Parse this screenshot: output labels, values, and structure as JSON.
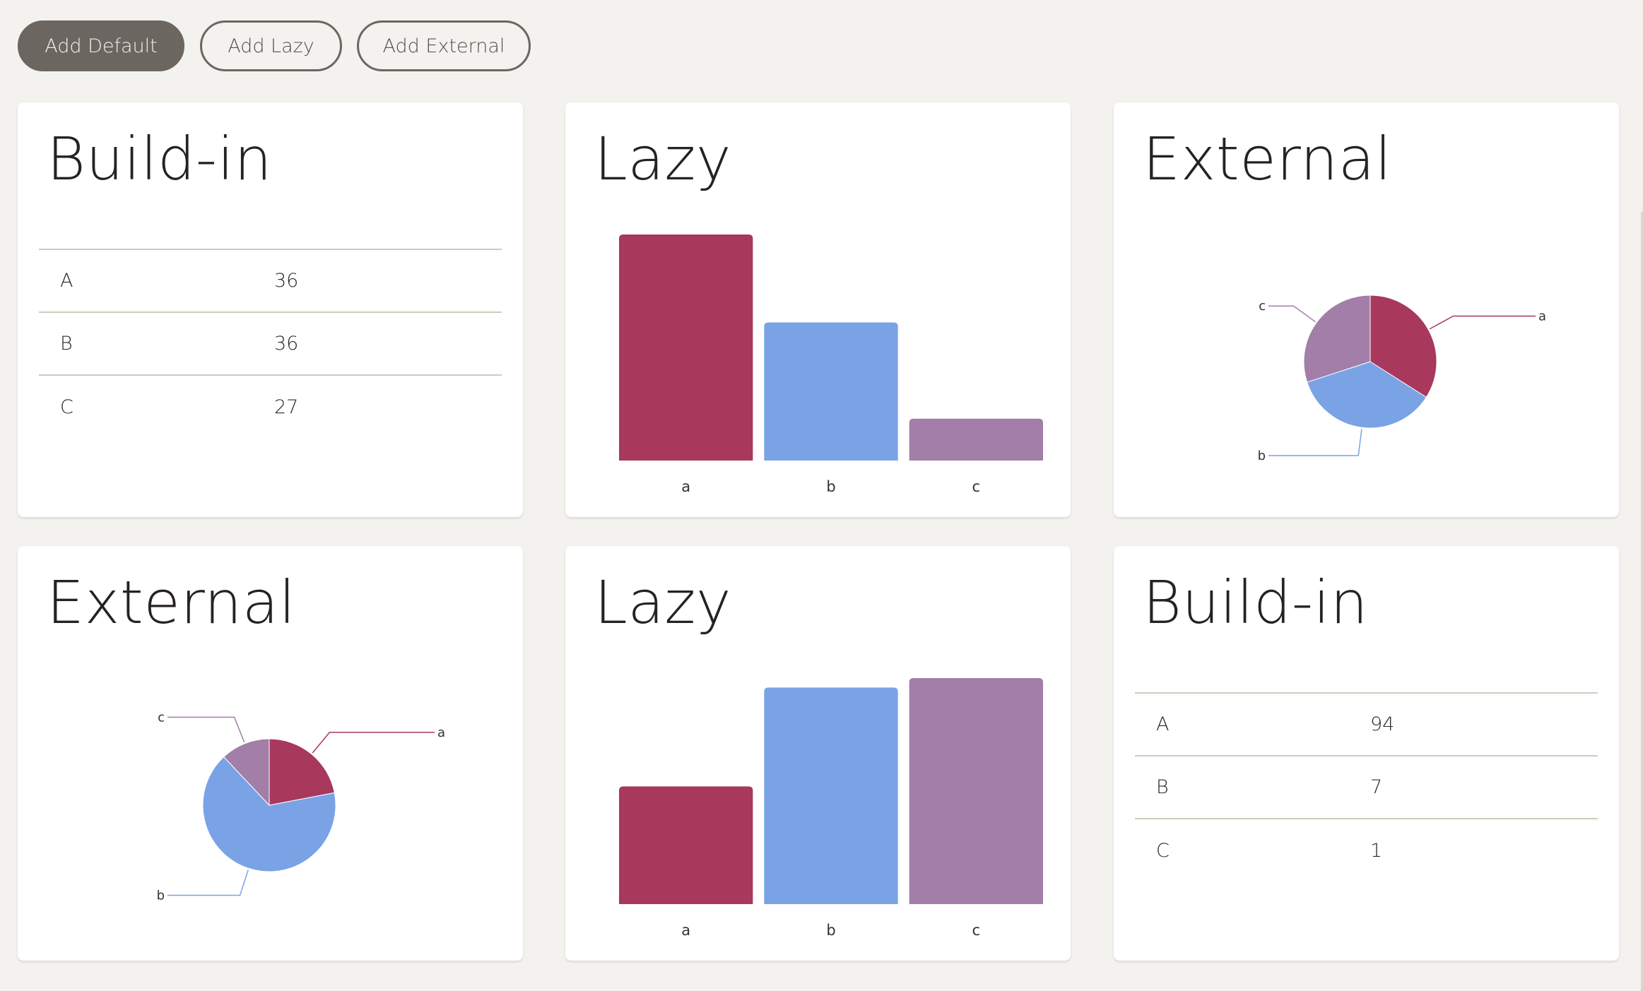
{
  "toolbar": {
    "add_default_label": "Add Default",
    "add_lazy_label": "Add Lazy",
    "add_external_label": "Add External"
  },
  "colors": {
    "a": "#a8385c",
    "b": "#7aa3e5",
    "c": "#a27ea8",
    "background": "#f3f2ef",
    "button_dark": "#6b6660"
  },
  "cards": [
    {
      "title": "Build-in",
      "kind": "table",
      "rows": [
        {
          "key": "A",
          "value": "36"
        },
        {
          "key": "B",
          "value": "36"
        },
        {
          "key": "C",
          "value": "27"
        }
      ]
    },
    {
      "title": "Lazy",
      "kind": "bar"
    },
    {
      "title": "External",
      "kind": "pie"
    },
    {
      "title": "External",
      "kind": "pie"
    },
    {
      "title": "Lazy",
      "kind": "bar"
    },
    {
      "title": "Build-in",
      "kind": "table",
      "rows": [
        {
          "key": "A",
          "value": "94"
        },
        {
          "key": "B",
          "value": "7"
        },
        {
          "key": "C",
          "value": "1"
        }
      ]
    }
  ],
  "chart_data": [
    {
      "type": "bar",
      "categories": [
        "a",
        "b",
        "c"
      ],
      "values": [
        54,
        33,
        10
      ],
      "ylim": [
        0,
        54
      ],
      "grid": false
    },
    {
      "type": "pie",
      "categories": [
        "a",
        "b",
        "c"
      ],
      "values": [
        34,
        36,
        30
      ]
    },
    {
      "type": "pie",
      "categories": [
        "a",
        "b",
        "c"
      ],
      "values": [
        22,
        66,
        12
      ]
    },
    {
      "type": "bar",
      "categories": [
        "a",
        "b",
        "c"
      ],
      "values": [
        50,
        92,
        96
      ],
      "ylim": [
        0,
        96
      ],
      "grid": false
    }
  ]
}
